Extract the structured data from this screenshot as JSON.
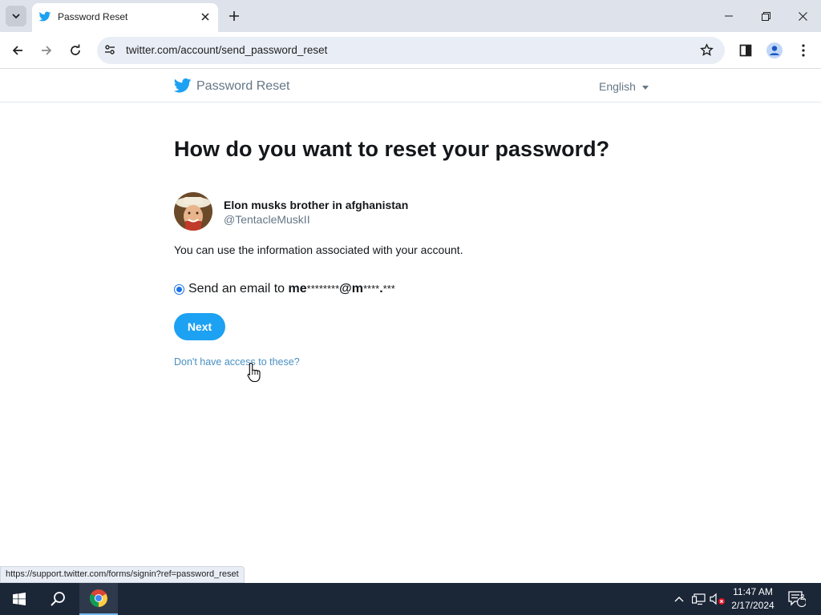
{
  "browser": {
    "tab_title": "Password Reset",
    "url": "twitter.com/account/send_password_reset",
    "status_url": "https://support.twitter.com/forms/signin?ref=password_reset"
  },
  "site": {
    "header_title": "Password Reset",
    "language": "English"
  },
  "page": {
    "heading": "How do you want to reset your password?",
    "account": {
      "display_name": "Elon musks brother in afghanistan",
      "handle": "@TentacleMuskII"
    },
    "info_text": "You can use the information associated with your account.",
    "option": {
      "prefix": "Send an email to ",
      "email_part1": "me",
      "email_mask1": "********",
      "email_part2": "@m",
      "email_mask2": "****",
      "email_part3": ".",
      "email_mask3": "***",
      "selected": true
    },
    "next_label": "Next",
    "help_link": "Don't have access to these?"
  },
  "taskbar": {
    "time": "11:47 AM",
    "date": "2/17/2024",
    "notification_count": "2"
  },
  "colors": {
    "twitter_blue": "#1da1f2",
    "link_blue": "#4a90c2",
    "radio_blue": "#1a73e8",
    "taskbar": "#1b2637"
  }
}
